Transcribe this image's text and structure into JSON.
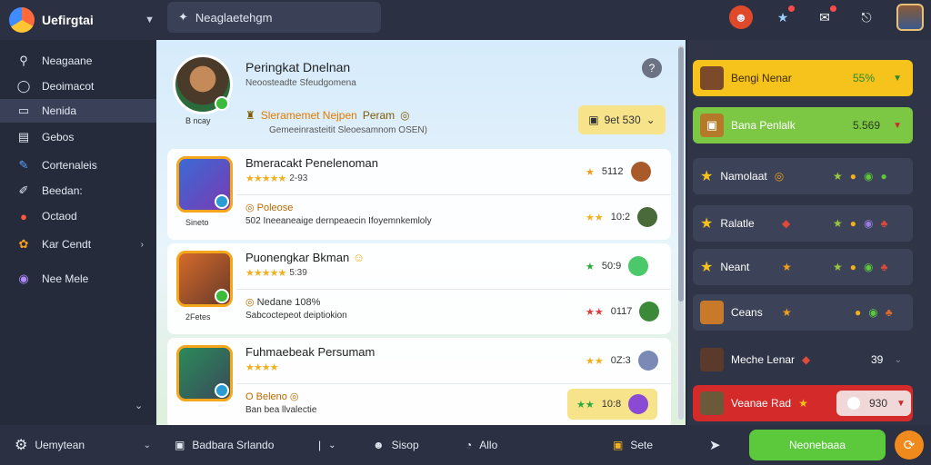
{
  "app": {
    "title": "Uefirgtai"
  },
  "search": {
    "text": "Neaglaetehgm"
  },
  "sidebar": {
    "items": [
      {
        "label": "Neagaane",
        "icon": "search-icon"
      },
      {
        "label": "Deoimacot",
        "icon": "chat-icon"
      },
      {
        "label": "Nenida",
        "icon": "list-icon"
      },
      {
        "label": "Gebos",
        "icon": "book-icon"
      },
      {
        "label": "Cortenaleis",
        "icon": "pencil-icon"
      },
      {
        "label": "Beedan:",
        "icon": "brush-icon"
      },
      {
        "label": "Octaod",
        "icon": "tomato-icon"
      },
      {
        "label": "Kar Cendt",
        "icon": "clover-icon"
      },
      {
        "label": "Nee Mele",
        "icon": "palette-icon"
      }
    ]
  },
  "hero": {
    "name": "Peringkat Dnelnan",
    "subtitle": "Neoosteadte Sfeudgomena",
    "avatar_caption": "B ncay",
    "line_orange": "Sleramemet Nejpen",
    "line_rest": "Peram",
    "line2": "Gemeeinrasteitit Sleoesamnom OSEN)",
    "pill_value": "9et 530"
  },
  "cards": [
    {
      "title": "Bmeracakt Penelenoman",
      "rating_value": "2-93",
      "caption": "Sineto",
      "tag": "Poleose",
      "desc": "502 Ineeaneaige dernpeaecin Ifoyemnkemloly",
      "right1_value": "5112",
      "right2_value": "10:2"
    },
    {
      "title": "Puonengkar Bkman",
      "rating_value": "5:39",
      "caption": "2Fetes",
      "tag": "Nedane 108%",
      "desc": "Sabcoctepeot deiptiokion",
      "right1_value": "50:9",
      "right2_value": "0117"
    },
    {
      "title": "Fuhmaebeak Persumam",
      "rating_value": "",
      "caption": "",
      "tag": "O Beleno",
      "desc": "Ban bea llvalectie",
      "right1_value": "0Z:3",
      "right2_value": "10:8"
    }
  ],
  "right_panel": {
    "items": [
      {
        "label": "Bengi Nenar",
        "value": "55%"
      },
      {
        "label": "Bana Penlalk",
        "value": "5.569"
      },
      {
        "label": "Namolaat"
      },
      {
        "label": "Ralatle"
      },
      {
        "label": "Neant"
      },
      {
        "label": "Ceans"
      },
      {
        "label": "Meche Lenar",
        "value": "39"
      },
      {
        "label": "Veanae Rad",
        "value": "930"
      }
    ]
  },
  "bottom": {
    "settings_label": "Uemytean",
    "item1": "Badbara Srlando",
    "item2": "Sisop",
    "item3": "Allo",
    "item4": "Sete",
    "button_label": "Neonebaaa"
  },
  "colors": {
    "accent_green": "#5cc83c",
    "accent_yellow": "#f6c21c",
    "accent_red": "#d42a2a",
    "accent_orange": "#f08a1c"
  }
}
